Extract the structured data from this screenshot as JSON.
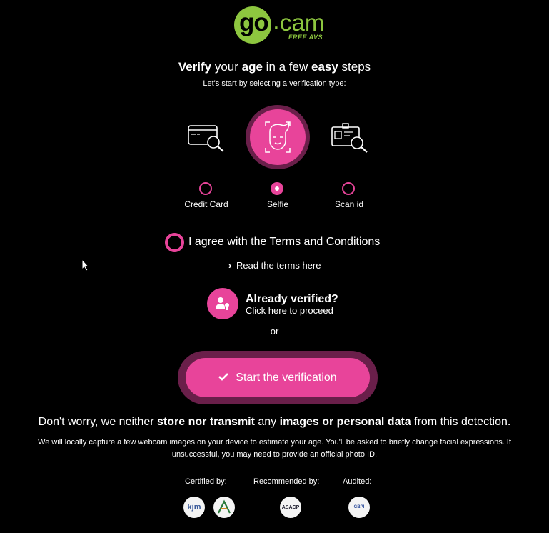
{
  "logo": {
    "go": "go",
    "dot": ".",
    "cam": "cam",
    "tagline": "FREE AVS"
  },
  "headline": {
    "part1": "Verify",
    "part2": " your ",
    "part3": "age",
    "part4": " in a few ",
    "part5": "easy",
    "part6": " steps"
  },
  "subhead": "Let's start by selecting a verification type:",
  "options": [
    {
      "label": "Credit Card",
      "selected": false,
      "icon": "credit-card-search-icon"
    },
    {
      "label": "Selfie",
      "selected": true,
      "icon": "selfie-face-icon"
    },
    {
      "label": "Scan id",
      "selected": false,
      "icon": "id-card-search-icon"
    }
  ],
  "terms": {
    "agree": "I agree with the Terms and Conditions",
    "read": "Read the terms here"
  },
  "already_verified": {
    "title": "Already verified?",
    "sub": "Click here to proceed"
  },
  "or": "or",
  "start_button": "Start the verification",
  "disclaimer": {
    "p1": "Don't worry, we neither ",
    "p2": "store nor transmit",
    "p3": " any ",
    "p4": "images or personal data",
    "p5": " from this detection."
  },
  "fineprint": "We will locally capture a few webcam images on your device to estimate your age. You'll be asked to briefly change facial expressions. If unsuccessful, you may need to provide an official photo ID.",
  "certifications": {
    "certified": "Certified by:",
    "recommended": "Recommended by:",
    "audited": "Audited:",
    "badges": [
      "kjm",
      "",
      "ASACP",
      "GBPI"
    ]
  },
  "colors": {
    "accent": "#e8449a",
    "accent_dark": "#6a1f4a",
    "brand_green": "#8dc63f",
    "background": "#000000"
  }
}
